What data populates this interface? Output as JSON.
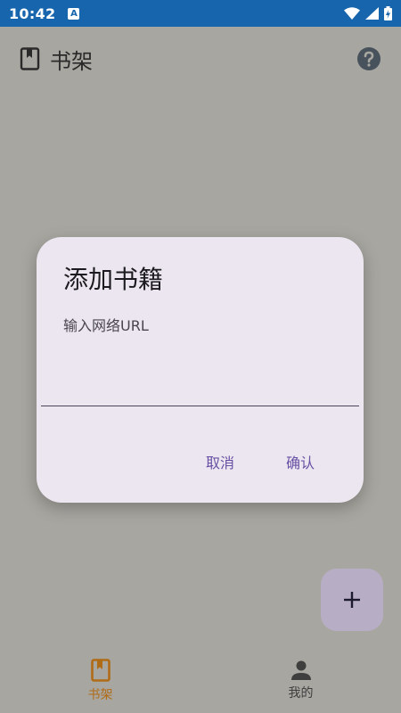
{
  "status_bar": {
    "time": "10:42",
    "app_indicator": "A",
    "icons": [
      "wifi-icon",
      "signal-icon",
      "battery-icon"
    ]
  },
  "app_bar": {
    "title": "书架",
    "icons": [
      "book-icon",
      "help-icon"
    ]
  },
  "dialog": {
    "title": "添加书籍",
    "input_label": "输入网络URL",
    "input_value": "",
    "cancel_label": "取消",
    "confirm_label": "确认"
  },
  "fab": {
    "icon": "plus-icon"
  },
  "bottom_nav": {
    "items": [
      {
        "label": "书架",
        "icon": "bookshelf-icon",
        "active": true
      },
      {
        "label": "我的",
        "icon": "person-icon",
        "active": false
      }
    ]
  },
  "colors": {
    "status_bar": "#1766ad",
    "scrim_background": "#a8a6a0",
    "dialog_surface": "#ece6f0",
    "primary": "#6750a4",
    "nav_active": "#b06b16",
    "fab": "#b7aec6"
  }
}
